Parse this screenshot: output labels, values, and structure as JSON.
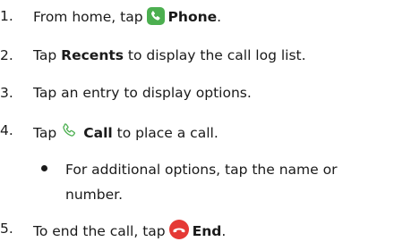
{
  "steps": [
    {
      "number": "1.",
      "before": "From home, tap",
      "icon": "phone-app-icon",
      "bold": "Phone",
      "after": "."
    },
    {
      "number": "2.",
      "before": "Tap ",
      "bold": "Recents",
      "after": " to display the call log list."
    },
    {
      "number": "3.",
      "text": "Tap an entry to display options."
    },
    {
      "number": "4.",
      "before": "Tap",
      "icon": "call-handset-icon",
      "bold": "Call",
      "after": " to place a call."
    },
    {
      "number": "5.",
      "before": "To end the call, tap",
      "icon": "end-call-icon",
      "bold": "End",
      "after": "."
    }
  ],
  "bullet": {
    "line1": "For additional options, tap the name or",
    "line2": "number."
  },
  "colors": {
    "phone_green": "#4CAF50",
    "end_red": "#E53935",
    "text": "#1a1a1a"
  }
}
